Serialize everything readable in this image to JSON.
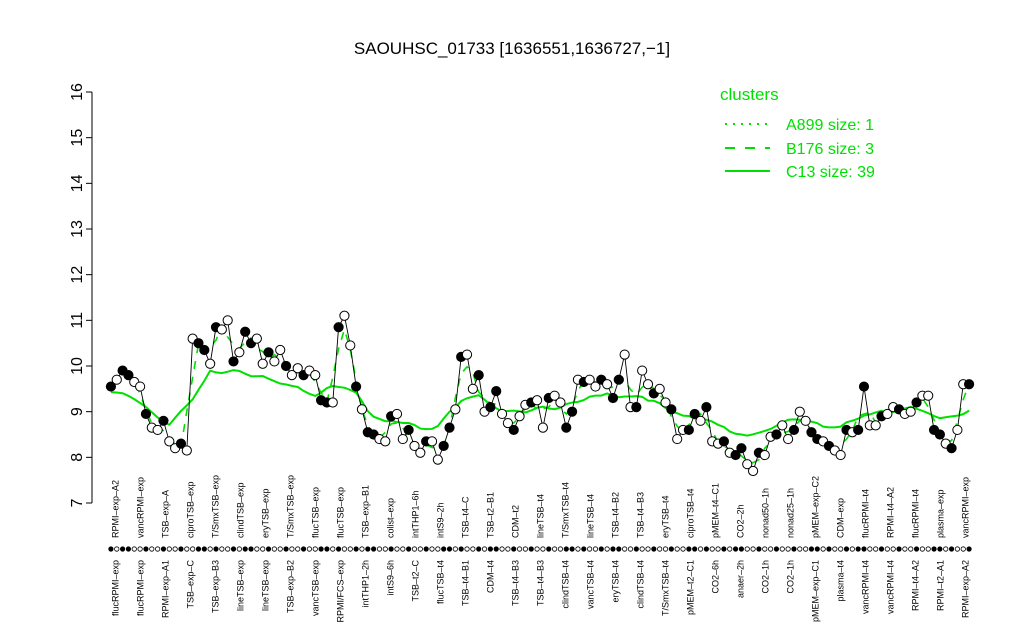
{
  "chart_data": {
    "type": "line",
    "title": "SAOUHSC_01733 [1636551,1636727,−1]",
    "xlabel": "",
    "ylabel": "",
    "ylim": [
      7,
      16
    ],
    "yticks": [
      7,
      8,
      9,
      10,
      11,
      12,
      13,
      14,
      15,
      16
    ],
    "grid": false,
    "colors": {
      "cluster_line": "#00e000",
      "axis": "#000000",
      "points_filled": "#000000",
      "points_open": "#ffffff"
    },
    "legend": {
      "title": "clusters",
      "placement": "top-right",
      "entries": [
        {
          "label": "A899 size: 1",
          "style": "dotted"
        },
        {
          "label": "B176 size: 3",
          "style": "dashed"
        },
        {
          "label": "C13 size: 39",
          "style": "solid"
        }
      ]
    },
    "labels_top": [
      "RPMI–exp–A2",
      "vancRPMI–exp",
      "TSB–exp–A",
      "ciproTSB–exp",
      "T/SmxTSB–exp",
      "clindTSB–exp",
      "eryTSB–exp",
      "T/SmxTSB–exp",
      "flucTSB–exp",
      "flucTSB–exp",
      "TSB–exp–B1",
      "colist–exp",
      "intTHP1–6h",
      "intS9–2h",
      "TSB–t4–C",
      "TSB–t2–B1",
      "CDM–t2",
      "lineTSB–t4",
      "T/SmxTSB–t4",
      "lineTSB–t4",
      "TSB–t4–B2",
      "TSB–t4–B3",
      "eryTSB–t4",
      "ciproTSB–t4",
      "pMEM–t4–C1",
      "CO2–2h",
      "nonad50–1h",
      "nonad25–1h",
      "pMEM–exp–C2",
      "CDM–exp",
      "flucRPMI–t4",
      "RPMI–t4–A2",
      "flucRPMI–t4",
      "plasma–exp",
      "vancRPMI–exp"
    ],
    "labels_bottom": [
      "flucRPMI–exp",
      "flucRPMI–exp",
      "RPMI–exp–A1",
      "TSB–exp–C",
      "TSB–exp–B3",
      "lineTSB–exp",
      "lineTSB–exp",
      "TSB–exp–B2",
      "vancTSB–exp",
      "RPMI/FCS–exp",
      "intTHP1–2h",
      "intS9–6h",
      "TSB–t2–C",
      "flucTSB–t4",
      "TSB–t4–B1",
      "CDM–t4",
      "TSB–t4–B3",
      "TSB–t4–B3",
      "clindTSB–t4",
      "vancTSB–t4",
      "eryTSB–t4",
      "clindTSB–t4",
      "T/SmxTSB–t4",
      "pMEM–t2–C1",
      "CO2–6h",
      "anaer–2h",
      "CO2–1h",
      "CO2–1h",
      "pMEM–exp–C1",
      "plasma–t4",
      "vancRPMI–t4",
      "vancRPMI–t4",
      "RPMI–t4–A2",
      "RPMI–t2–A1",
      "RPMI–exp–A2"
    ],
    "series": [
      {
        "values": [
          9.55,
          9.7,
          9.9,
          9.8,
          9.65,
          9.55,
          8.95,
          8.65,
          8.6,
          8.8,
          8.35,
          8.2,
          8.3,
          8.15,
          10.6,
          10.5,
          10.35,
          10.05,
          10.85,
          10.8,
          11.0,
          10.1,
          10.3,
          10.75,
          10.5,
          10.6,
          10.05,
          10.3,
          10.1,
          10.35,
          10.0,
          9.8,
          9.95,
          9.8,
          9.9,
          9.8,
          9.25,
          9.2,
          9.2,
          10.85,
          11.1,
          10.45,
          9.55,
          9.05,
          8.55,
          8.5,
          8.4,
          8.35,
          8.9,
          8.95,
          8.4,
          8.6,
          8.25,
          8.1,
          8.35,
          8.35,
          7.95,
          8.25,
          8.65,
          9.05,
          10.2,
          10.25,
          9.5,
          9.8,
          9.0,
          9.1,
          9.45,
          8.95,
          8.75,
          8.6,
          8.9,
          9.15,
          9.2,
          9.25,
          8.65,
          9.3,
          9.35,
          9.2,
          8.65,
          9.0,
          9.7,
          9.65,
          9.7,
          9.55,
          9.7,
          9.6,
          9.3,
          9.7,
          10.25,
          9.1,
          9.1,
          9.9,
          9.6,
          9.4,
          9.5,
          9.2,
          9.05,
          8.4,
          8.6,
          8.6,
          8.95,
          8.8,
          9.1,
          8.35,
          8.3,
          8.35,
          8.1,
          8.05,
          8.2,
          7.85,
          7.7,
          8.1,
          8.05,
          8.45,
          8.5,
          8.7,
          8.4,
          8.6,
          9.0,
          8.8,
          8.55,
          8.4,
          8.35,
          8.25,
          8.15,
          8.05,
          8.6,
          8.55,
          8.6,
          9.55,
          8.7,
          8.7,
          8.9,
          8.95,
          9.1,
          9.05,
          8.95,
          9.0,
          9.2,
          9.35,
          9.35,
          8.6,
          8.5,
          8.3,
          8.2,
          8.6,
          9.6,
          9.6
        ]
      }
    ]
  }
}
